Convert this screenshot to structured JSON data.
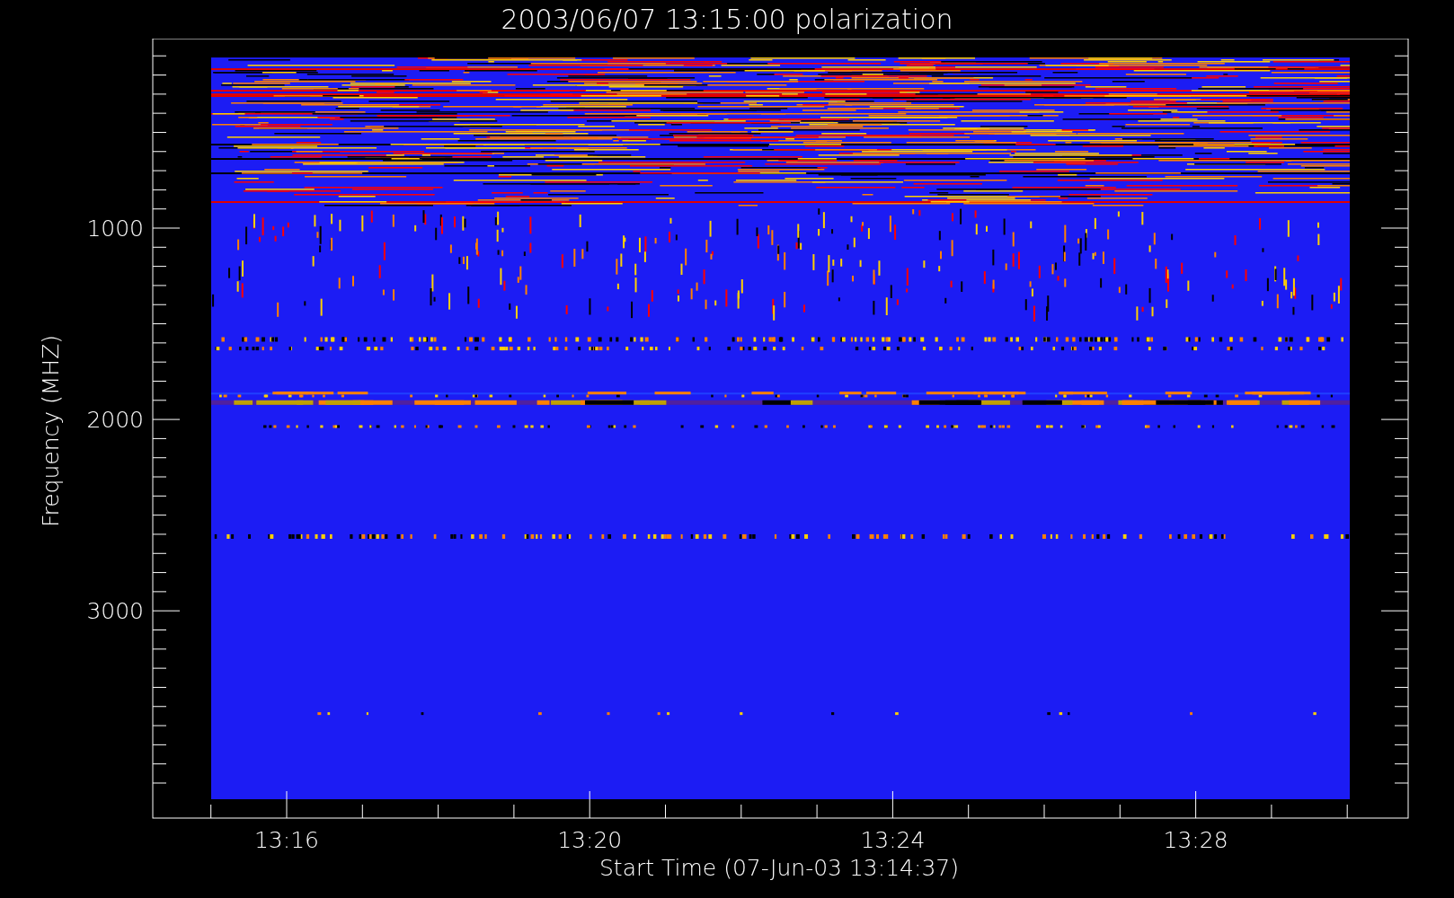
{
  "plot": {
    "title": "2003/06/07 13:15:00 polarization",
    "xlabel": "Start Time (07-Jun-03 13:14:37)",
    "ylabel": "Frequency (MHZ)",
    "xtick_labels": [
      "13:16",
      "13:20",
      "13:24",
      "13:28"
    ],
    "ytick_labels": [
      "1000",
      "2000",
      "3000"
    ]
  }
}
